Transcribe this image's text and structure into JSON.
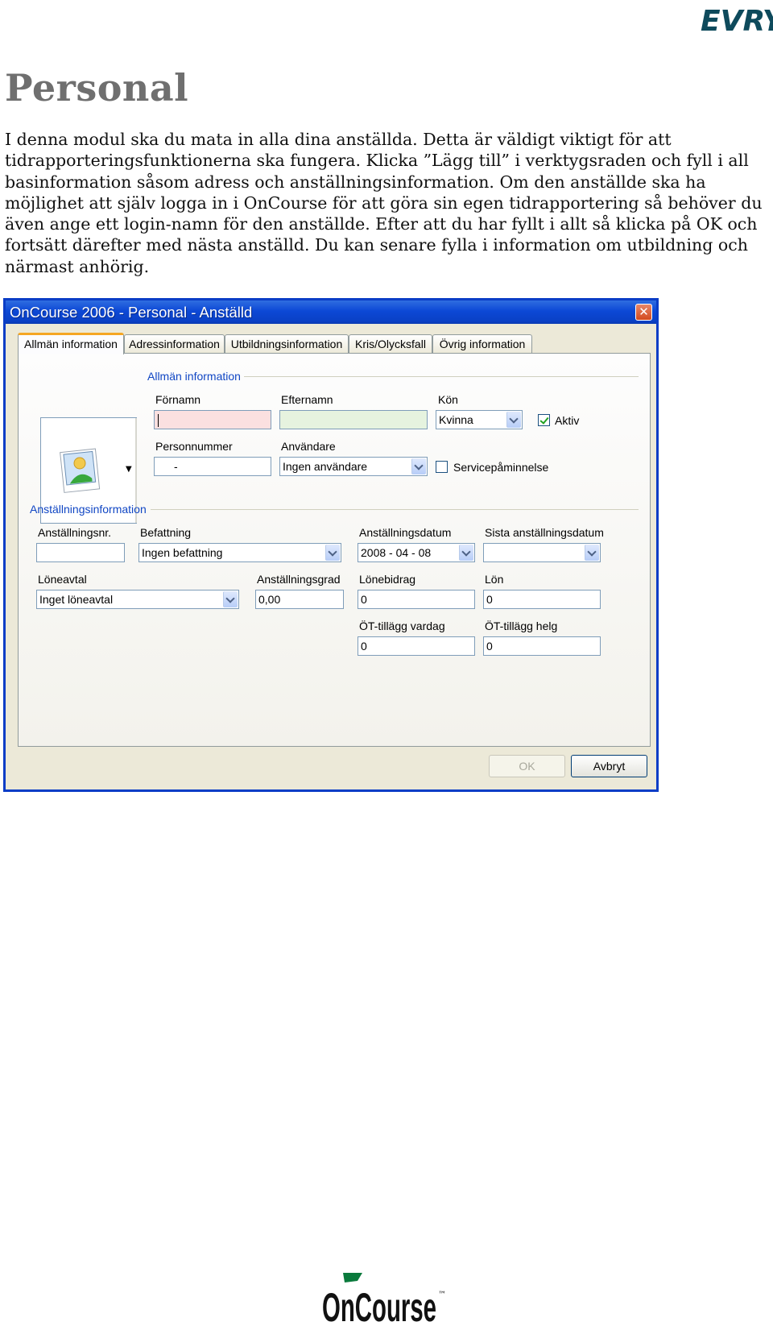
{
  "page": {
    "title": "Personal",
    "intro_lines": [
      "I denna modul ska du mata in alla dina anställda. Detta är väldigt viktigt för att",
      "tidrapporteringsfunktionerna ska fungera. Klicka ”Lägg till” i verktygsraden och fyll i all",
      "basinformation såsom adress och anställningsinformation. Om den anställde ska ha",
      "möjlighet att själv logga in i OnCourse för att göra sin egen tidrapportering så behöver du",
      "även ange ett login-namn för den anställde. Efter att du har fyllt i allt så klicka på OK och",
      "fortsätt därefter med nästa anställd. Du kan senare fylla i information om utbildning och",
      "närmast anhörig."
    ]
  },
  "logos": {
    "evry": "EVRY",
    "oncourse": "OnCourse",
    "oncourse_tm": "™"
  },
  "window": {
    "title": "OnCourse 2006 - Personal - Anställd",
    "close_glyph": "✕",
    "tabs": [
      {
        "label": "Allmän information",
        "active": true
      },
      {
        "label": "Adressinformation"
      },
      {
        "label": "Utbildningsinformation"
      },
      {
        "label": "Kris/Olycksfall"
      },
      {
        "label": "Övrig information"
      }
    ],
    "general": {
      "group_title": "Allmän information",
      "fornamn_label": "Förnamn",
      "fornamn_value": "",
      "efternamn_label": "Efternamn",
      "efternamn_value": "",
      "kon_label": "Kön",
      "kon_value": "Kvinna",
      "aktiv_label": "Aktiv",
      "aktiv_checked": true,
      "personnummer_label": "Personnummer",
      "personnummer_value": "-",
      "anvandare_label": "Användare",
      "anvandare_value": "Ingen användare",
      "service_label": "Servicepåminnelse",
      "service_checked": false,
      "photo_drop_glyph": "▼"
    },
    "employment": {
      "group_title": "Anställningsinformation",
      "anstnr_label": "Anställningsnr.",
      "anstnr_value": "",
      "befattning_label": "Befattning",
      "befattning_value": "Ingen befattning",
      "anstdatum_label": "Anställningsdatum",
      "anstdatum_value": "2008 - 04 - 08",
      "sista_label": "Sista anställningsdatum",
      "sista_value": "-    -",
      "loneavtal_label": "Löneavtal",
      "loneavtal_value": "Inget löneavtal",
      "anstgrad_label": "Anställningsgrad",
      "anstgrad_value": "0,00",
      "lonebidrag_label": "Lönebidrag",
      "lonebidrag_value": "0",
      "lon_label": "Lön",
      "lon_value": "0",
      "ot_vardag_label": "ÖT-tillägg vardag",
      "ot_vardag_value": "0",
      "ot_helg_label": "ÖT-tillägg helg",
      "ot_helg_value": "0"
    },
    "buttons": {
      "ok": "OK",
      "cancel": "Avbryt"
    }
  },
  "colors": {
    "window_border": "#0a3dc6",
    "group_title": "#1046c4",
    "evry": "#0e4a5c",
    "oncourse_green": "#0a7a3c"
  }
}
